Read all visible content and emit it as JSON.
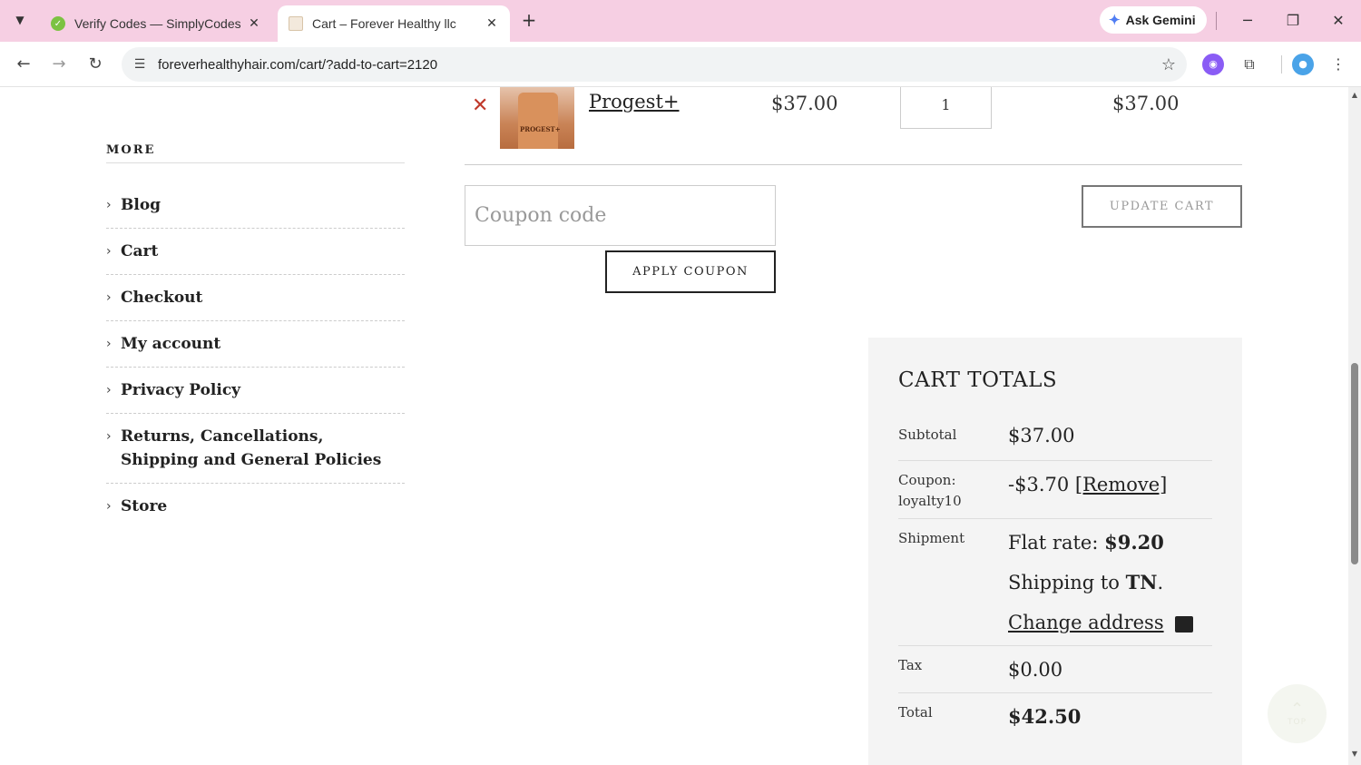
{
  "browser": {
    "tabs": [
      {
        "title": "Verify Codes — SimplyCodes",
        "active": false
      },
      {
        "title": "Cart – Forever Healthy llc",
        "active": true
      }
    ],
    "gemini_label": "Ask Gemini",
    "url": "foreverhealthyhair.com/cart/?add-to-cart=2120",
    "icons": {
      "tab_search": "chevron-down-icon",
      "new_tab": "plus-icon",
      "back": "arrow-left-icon",
      "forward": "arrow-right-icon",
      "reload": "reload-icon",
      "site_info": "tune-icon",
      "bookmark": "star-icon",
      "extensions": "puzzle-icon",
      "menu": "kebab-menu-icon"
    }
  },
  "sidebar": {
    "title": "MORE",
    "items": [
      {
        "label": "Blog"
      },
      {
        "label": "Cart"
      },
      {
        "label": "Checkout"
      },
      {
        "label": "My account"
      },
      {
        "label": "Privacy Policy"
      },
      {
        "label": "Returns, Cancellations, Shipping and General Policies"
      },
      {
        "label": "Store"
      }
    ]
  },
  "cart": {
    "item": {
      "name": "Progest+",
      "image_label": "PROGEST+",
      "price": "$37.00",
      "quantity": "1",
      "subtotal": "$37.00"
    },
    "coupon_placeholder": "Coupon code",
    "apply_coupon_label": "APPLY COUPON",
    "update_cart_label": "UPDATE CART"
  },
  "totals": {
    "title": "CART TOTALS",
    "subtotal_label": "Subtotal",
    "subtotal_value": "$37.00",
    "coupon_label": "Coupon: loyalty10",
    "coupon_value": "-$3.70",
    "coupon_remove": "[Remove]",
    "shipment_label": "Shipment",
    "shipment_rate_prefix": "Flat rate: ",
    "shipment_rate_value": "$9.20",
    "shipping_to_prefix": "Shipping to ",
    "shipping_to_state": "TN",
    "shipping_to_suffix": ".",
    "change_address": "Change address",
    "tax_label": "Tax",
    "tax_value": "$0.00",
    "total_label": "Total",
    "total_value": "$42.50"
  },
  "scroll_top_label": "TOP",
  "colors": {
    "tabbar_bg": "#f6cfe3",
    "remove_red": "#c0392b",
    "totals_bg": "#f4f4f4"
  }
}
